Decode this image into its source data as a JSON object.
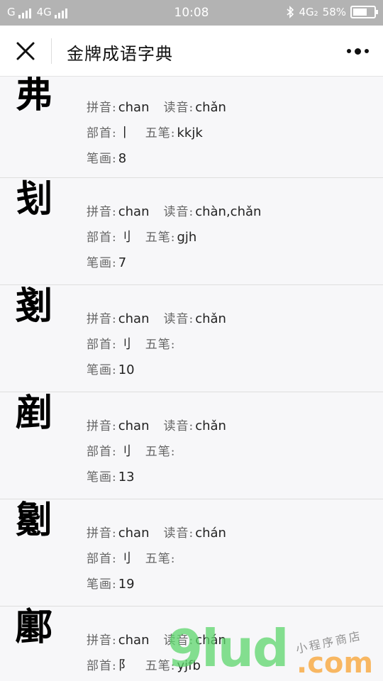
{
  "status_bar": {
    "carrier": "G",
    "network": "4G",
    "time": "10:08",
    "network_right": "4G₂",
    "battery": "58%"
  },
  "navbar": {
    "title": "金牌成语字典"
  },
  "labels": {
    "pinyin": "拼音:",
    "reading": "读音:",
    "radical": "部首:",
    "wubi": "五笔:",
    "strokes": "笔画:"
  },
  "entries": [
    {
      "char": "弗",
      "pinyin": "chan",
      "reading": "chǎn",
      "radical": "丨",
      "wubi": "kkjk",
      "strokes": "8"
    },
    {
      "char": "刬",
      "pinyin": "chan",
      "reading": "chàn,chǎn",
      "radical": "刂",
      "wubi": "gjh",
      "strokes": "7"
    },
    {
      "char": "剗",
      "pinyin": "chan",
      "reading": "chǎn",
      "radical": "刂",
      "wubi": "",
      "strokes": "10"
    },
    {
      "char": "剷",
      "pinyin": "chan",
      "reading": "chǎn",
      "radical": "刂",
      "wubi": "",
      "strokes": "13"
    },
    {
      "char": "劖",
      "pinyin": "chan",
      "reading": "chán",
      "radical": "刂",
      "wubi": "",
      "strokes": "19"
    },
    {
      "char": "鄽",
      "pinyin": "chan",
      "reading": "chán",
      "radical": "阝",
      "wubi": "yjfb",
      "strokes": ""
    }
  ],
  "watermark": {
    "main": "9lud",
    "suffix": ".com",
    "sub": "小程序商店"
  },
  "colors": {
    "status_bg": "#b3b3b3",
    "page_bg": "#f7f7f9",
    "watermark_green": "#5cd66b",
    "watermark_orange": "#f8a63c"
  }
}
